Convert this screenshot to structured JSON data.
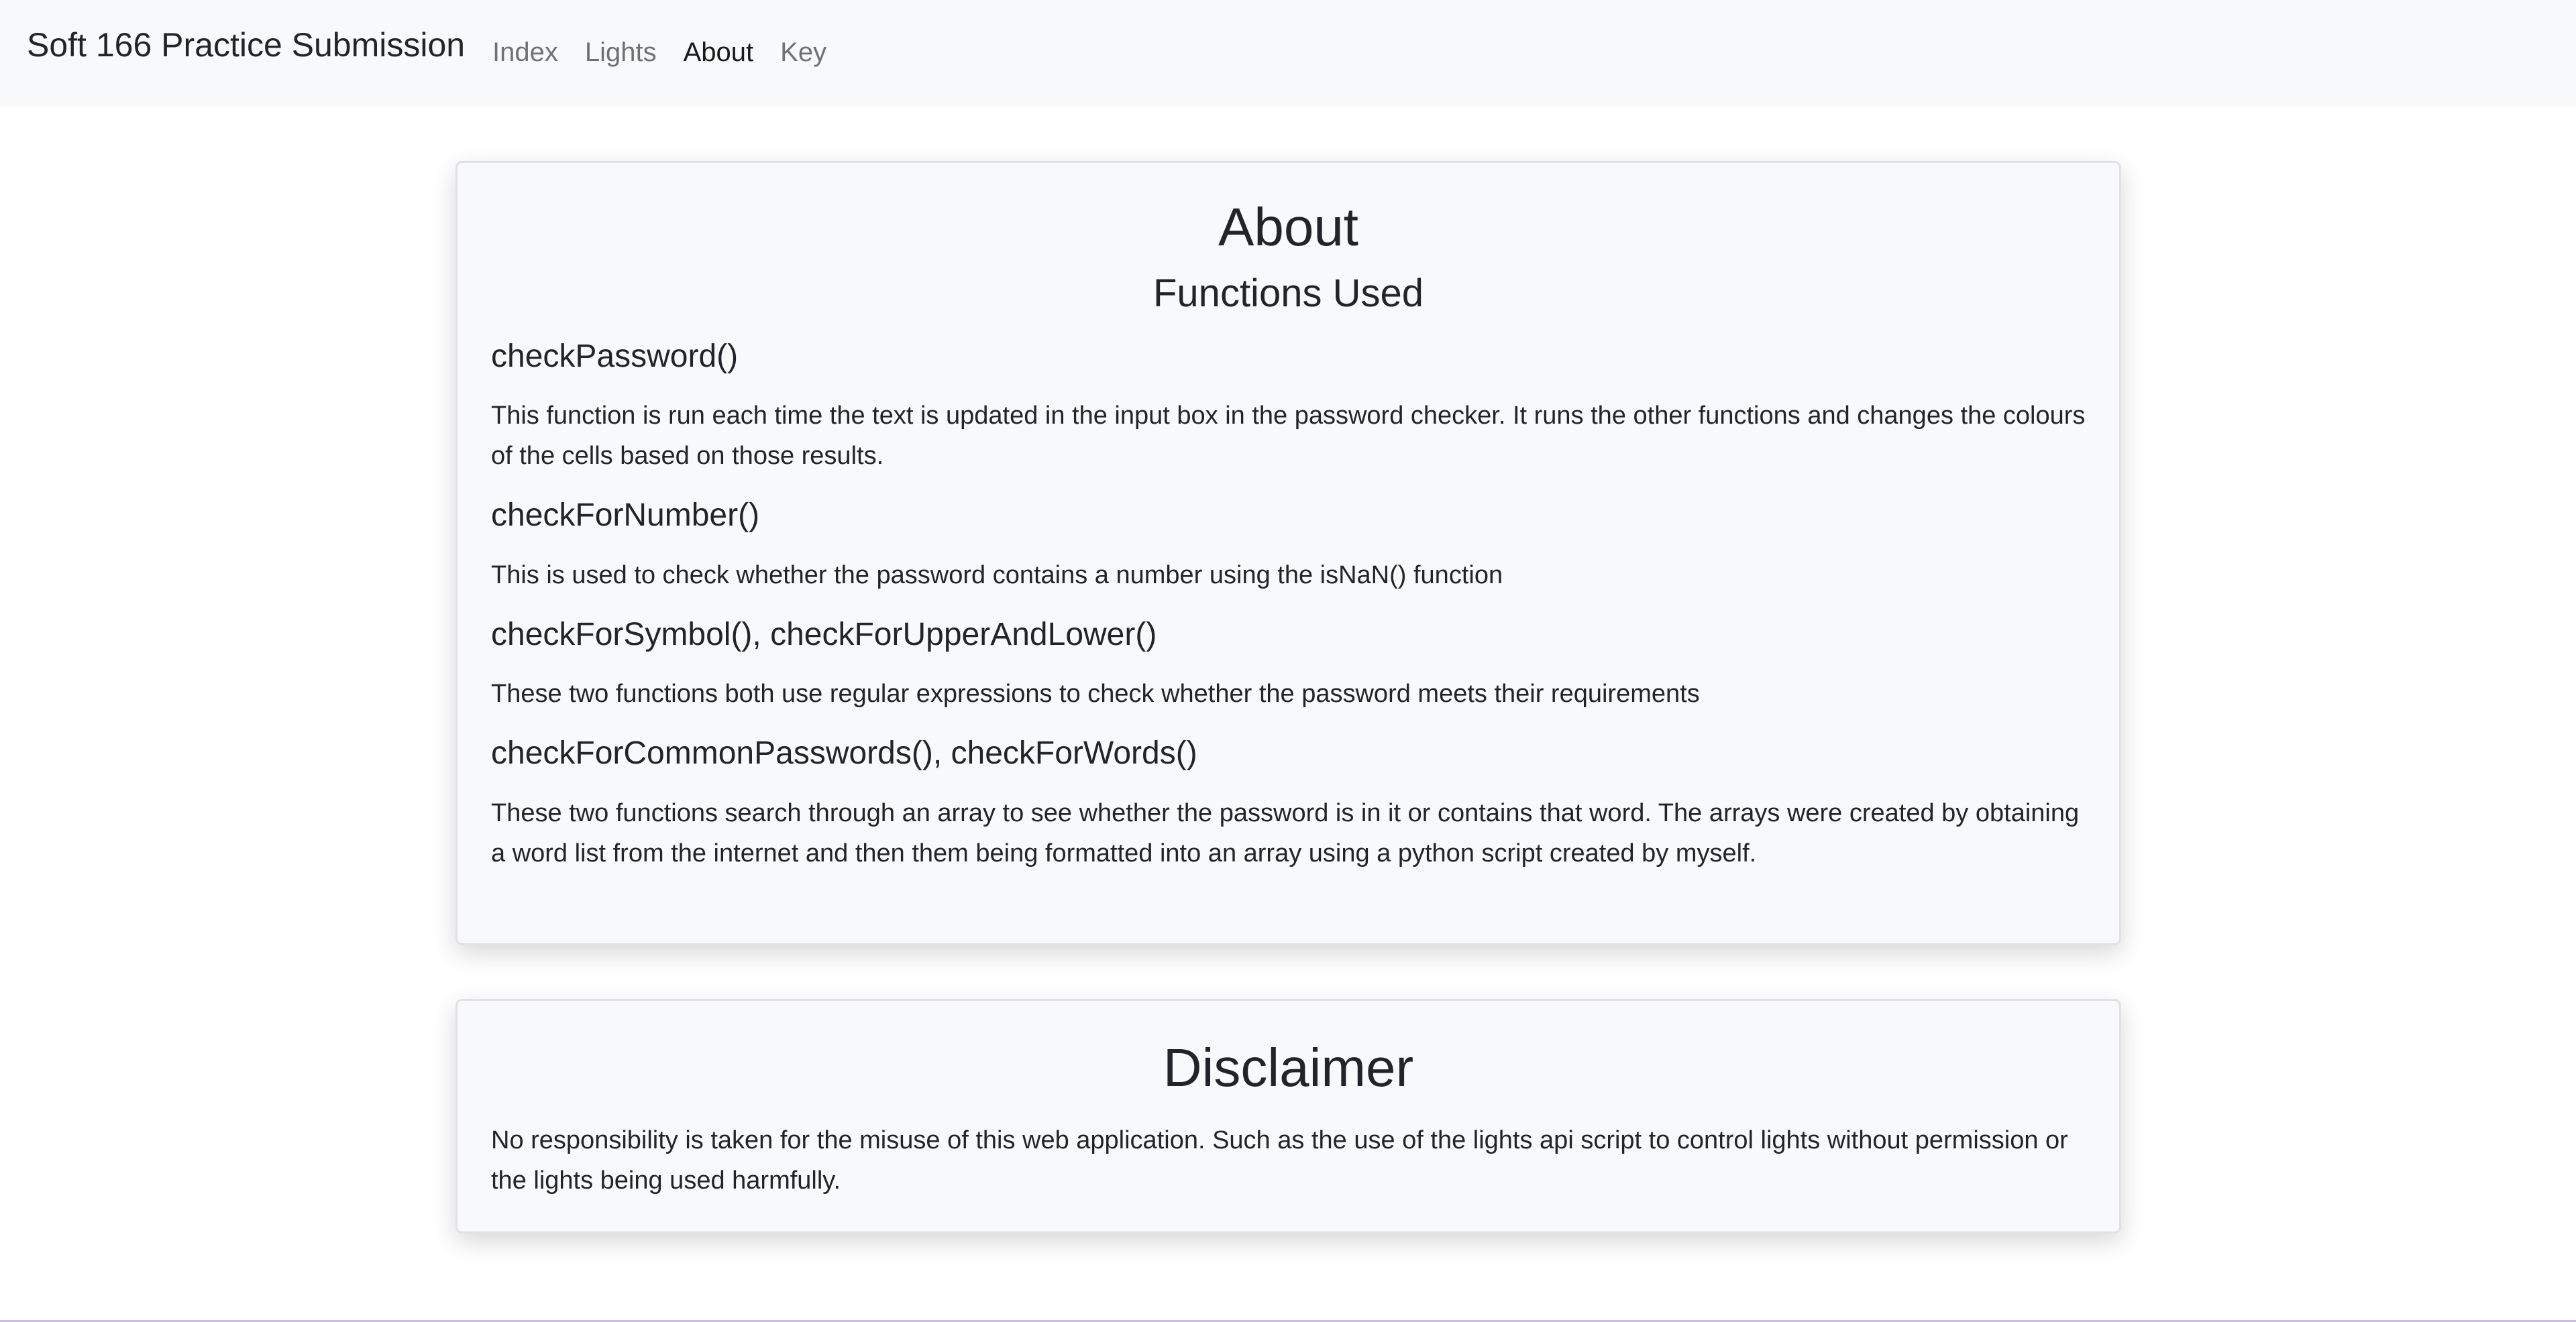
{
  "navbar": {
    "brand": "Soft 166 Practice Submission",
    "links": [
      {
        "label": "Index"
      },
      {
        "label": "Lights"
      },
      {
        "label": "About"
      },
      {
        "label": "Key"
      }
    ]
  },
  "about": {
    "title": "About",
    "subtitle": "Functions Used",
    "functions": [
      {
        "name": "checkPassword()",
        "description": "This function is run each time the text is updated in the input box in the password checker. It runs the other functions and changes the colours of the cells based on those results."
      },
      {
        "name": "checkForNumber()",
        "description": "This is used to check whether the password contains a number using the isNaN() function"
      },
      {
        "name": "checkForSymbol(), checkForUpperAndLower()",
        "description": "These two functions both use regular expressions to check whether the password meets their requirements"
      },
      {
        "name": "checkForCommonPasswords(), checkForWords()",
        "description": "These two functions search through an array to see whether the password is in it or contains that word. The arrays were created by obtaining a word list from the internet and then them being formatted into an array using a python script created by myself."
      }
    ]
  },
  "disclaimer": {
    "title": "Disclaimer",
    "text": "No responsibility is taken for the misuse of this web application. Such as the use of the lights api script to control lights without permission or the lights being used harmfully."
  }
}
